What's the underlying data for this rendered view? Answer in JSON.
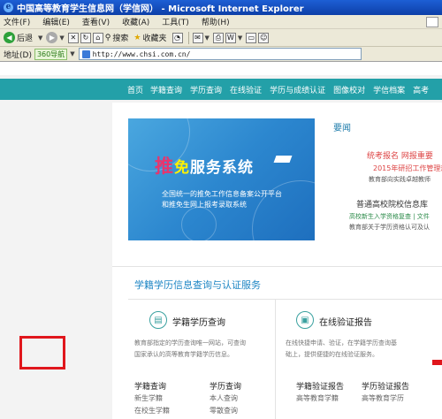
{
  "window": {
    "title": "中国高等教育学生信息网（学信网） - Microsoft Internet Explorer"
  },
  "menu": [
    "文件(F)",
    "编辑(E)",
    "查看(V)",
    "收藏(A)",
    "工具(T)",
    "帮助(H)"
  ],
  "toolbar": {
    "back_label": "后退",
    "search_label": "搜索",
    "favorites_label": "收藏夹"
  },
  "addressbar": {
    "label": "地址(D)",
    "nav360": "360导航",
    "url": "http://www.chsi.com.cn/"
  },
  "site": {
    "nav": [
      "首页",
      "学籍查询",
      "学历查询",
      "在线验证",
      "学历与成绩认证",
      "图像校对",
      "学信档案",
      "高考"
    ],
    "banner": {
      "title_tui": "推",
      "title_mian": "免",
      "title_rest": "服务系统",
      "sub1": "全国统一的推免工作信息备案公开平台",
      "sub2": "和推免生网上报考录取系统"
    },
    "news": {
      "title": "要闻",
      "line1": "统考报名  网报重要",
      "line2": "2015年研招工作管理规",
      "line3": "教育部向实践卓越教师",
      "line4": "普通高校院校信息库",
      "line5": "高校新生入学资格复查 | 文件",
      "line6": "教育部关于学历资格认可及认"
    },
    "service": {
      "title": "学籍学历信息查询与认证服务",
      "left": {
        "heading": "学籍学历查询",
        "desc1": "教育部指定的学历查询唯一网站，可查询",
        "desc2": "国家承认的高等教育学籍学历信息。",
        "col1_title": "学籍查询",
        "col1_l1": "新生学籍",
        "col1_l2": "在校生学籍",
        "col2_title": "学历查询",
        "col2_l1": "本人查询",
        "col2_l2": "零散查询"
      },
      "right": {
        "heading": "在线验证报告",
        "desc1": "在线快捷申请、验证，在学籍学历查询基",
        "desc2": "础上，提供便捷的在线验证服务。",
        "col1_title": "学籍验证报告",
        "col1_l1": "高等教育学籍",
        "col2_title": "学历验证报告",
        "col2_l1": "高等教育学历"
      }
    }
  }
}
